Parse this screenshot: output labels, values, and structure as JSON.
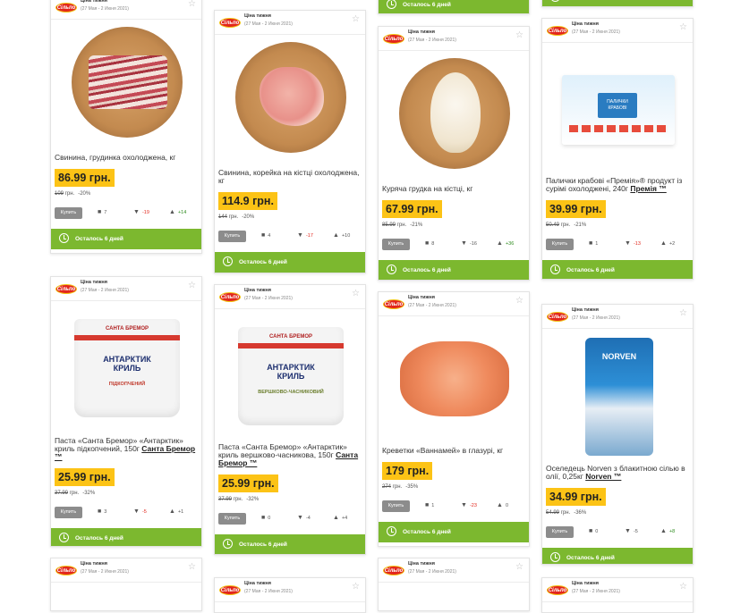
{
  "header": {
    "title": "Ціна тижня",
    "date": "(27 Мая - 2 Июня 2021)",
    "logo_text": "Сільпо"
  },
  "common": {
    "buy_label": "Купить",
    "timer_label": "Осталось 6 дней",
    "currency_unit": "грн.",
    "logo_colors": {
      "red": "#e2261c",
      "yellow": "#f3c316"
    },
    "price_bg": "#fcc316",
    "green_bar": "#7cb82f"
  },
  "cards": [
    {
      "name": "Свинина, грудинка охолоджена, кг",
      "brand": "",
      "price": "86.99 грн.",
      "old_price": "109",
      "discount": "-20%",
      "comments": "7",
      "dislikes": "-19",
      "likes": "+14"
    },
    {
      "name": "Свинина, корейка на кістці охолоджена, кг",
      "brand": "",
      "price": "114.9 грн.",
      "old_price": "144",
      "discount": "-20%",
      "comments": "4",
      "dislikes": "-17",
      "likes": "+10"
    },
    {
      "name": "Куряча грудка на кістці, кг",
      "brand": "",
      "price": "67.99 грн.",
      "old_price": "85.99",
      "discount": "-21%",
      "comments": "8",
      "dislikes": "-16",
      "likes": "+36"
    },
    {
      "name": "Палички крабові «Премія»® продукт із сурімі охолоджені, 240г",
      "brand": "Премія ™",
      "price": "39.99 грн.",
      "old_price": "50.49",
      "discount": "-21%",
      "comments": "1",
      "dislikes": "-13",
      "likes": "+2"
    },
    {
      "name": "Паста «Санта Бремор» «Антарктик» криль підкопчений, 150г",
      "brand": "Санта Бремор ™",
      "price": "25.99 грн.",
      "old_price": "37.99",
      "discount": "-32%",
      "comments": "3",
      "dislikes": "-5",
      "likes": "+1"
    },
    {
      "name": "Паста «Санта Бремор» «Антарктик» криль вершково-часникова, 150г",
      "brand": "Санта Бремор ™",
      "price": "25.99 грн.",
      "old_price": "37.99",
      "discount": "-32%",
      "comments": "0",
      "dislikes": "-4",
      "likes": "+4"
    },
    {
      "name": "Креветки «Ваннамей» в глазурі, кг",
      "brand": "",
      "price": "179 грн.",
      "old_price": "274",
      "discount": "-35%",
      "comments": "1",
      "dislikes": "-23",
      "likes": "0"
    },
    {
      "name": "Оселедець Norven з блакитною сілью в олії, 0,25кг",
      "brand": "Norven ™",
      "price": "34.99 грн.",
      "old_price": "54.99",
      "discount": "-36%",
      "comments": "0",
      "dislikes": "-5",
      "likes": "+8"
    }
  ],
  "images": {
    "tub_brand": "САНТА БРЕМОР",
    "tub_title": "АНТАРКТИК КРИЛЬ",
    "tub1_flavor": "ПІДКОПЧЕНИЙ",
    "tub2_flavor": "ВЕРШКОВО-ЧАСНИКОВИЙ",
    "crab_pack": "ПАЛИЧКИ КРАБОВІ",
    "herring_pack": "NORVEN"
  },
  "icons": {
    "star": "star-icon",
    "comment": "comment-icon",
    "dislike": "thumb-down-icon",
    "like": "thumb-up-icon",
    "timer": "clock-icon"
  }
}
